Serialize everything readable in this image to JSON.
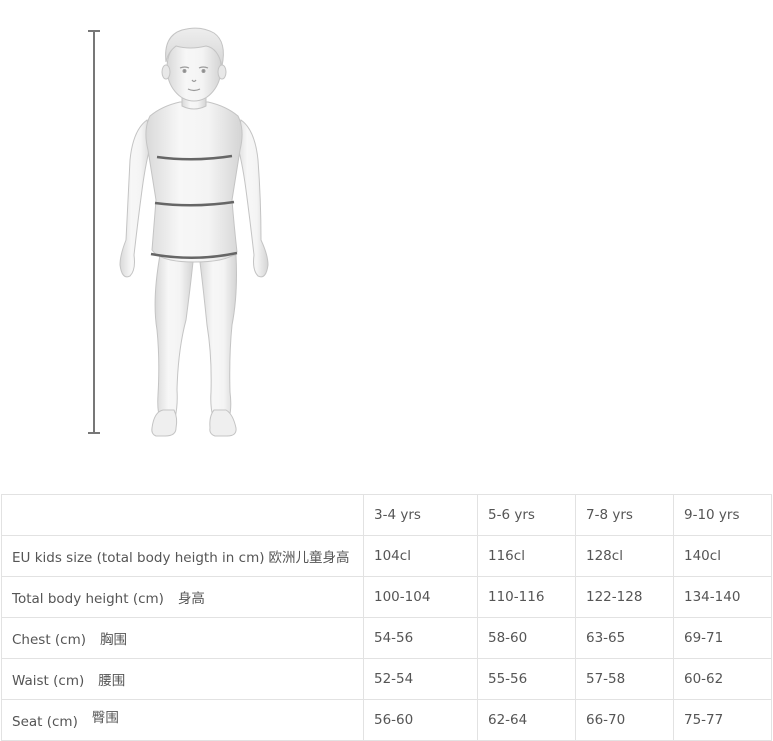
{
  "size_table": {
    "header": [
      "",
      "3-4 yrs",
      "5-6 yrs",
      "7-8 yrs",
      "9-10 yrs"
    ],
    "rows": [
      {
        "label": "EU kids size (total body heigth in cm)",
        "label_cn": "欧洲儿童身高",
        "values": [
          "104cl",
          "116cl",
          "128cl",
          "140cl"
        ]
      },
      {
        "label": "Total body height (cm)",
        "label_cn": "身高",
        "values": [
          "100-104",
          "110-116",
          "122-128",
          "134-140"
        ]
      },
      {
        "label": "Chest (cm)",
        "label_cn": "胸围",
        "values": [
          "54-56",
          "58-60",
          "63-65",
          "69-71"
        ]
      },
      {
        "label": "Waist (cm)",
        "label_cn": "腰围",
        "values": [
          "52-54",
          "55-56",
          "57-58",
          "60-62"
        ]
      },
      {
        "label": "Seat (cm)",
        "label_cn": "臀围",
        "values": [
          "56-60",
          "62-64",
          "66-70",
          "75-77"
        ]
      }
    ]
  }
}
